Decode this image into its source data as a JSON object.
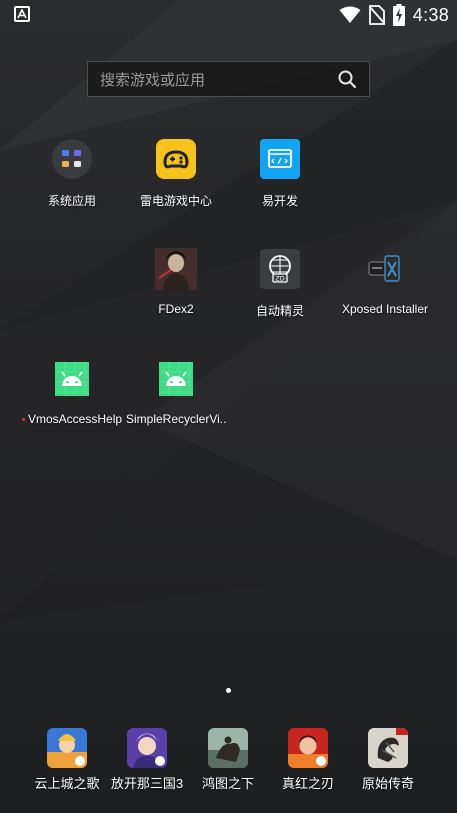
{
  "status_bar": {
    "time": "4:38"
  },
  "search": {
    "placeholder": "搜索游戏或应用"
  },
  "apps": {
    "system_apps": "系统应用",
    "leidian_game_center": "雷电游戏中心",
    "yikaifa": "易开发",
    "fdex2": "FDex2",
    "auto_sprite": "自动精灵",
    "xposed_installer": "Xposed Installer",
    "vmos_access_helper": "VmosAccessHelp..",
    "simple_recycler_view": "SimpleRecyclerVi.."
  },
  "dock": {
    "app1": "云上城之歌",
    "app2": "放开那三国3",
    "app3": "鸿图之下",
    "app4": "真红之刃",
    "app5": "原始传奇"
  },
  "colors": {
    "accent_yellow": "#f6c21c",
    "accent_blue": "#12a4f3",
    "android_green": "#3ddc84"
  },
  "icons": {
    "search": "search-icon",
    "wifi": "wifi-icon",
    "no_sim": "no-sim-icon",
    "battery": "battery-charging-icon"
  }
}
